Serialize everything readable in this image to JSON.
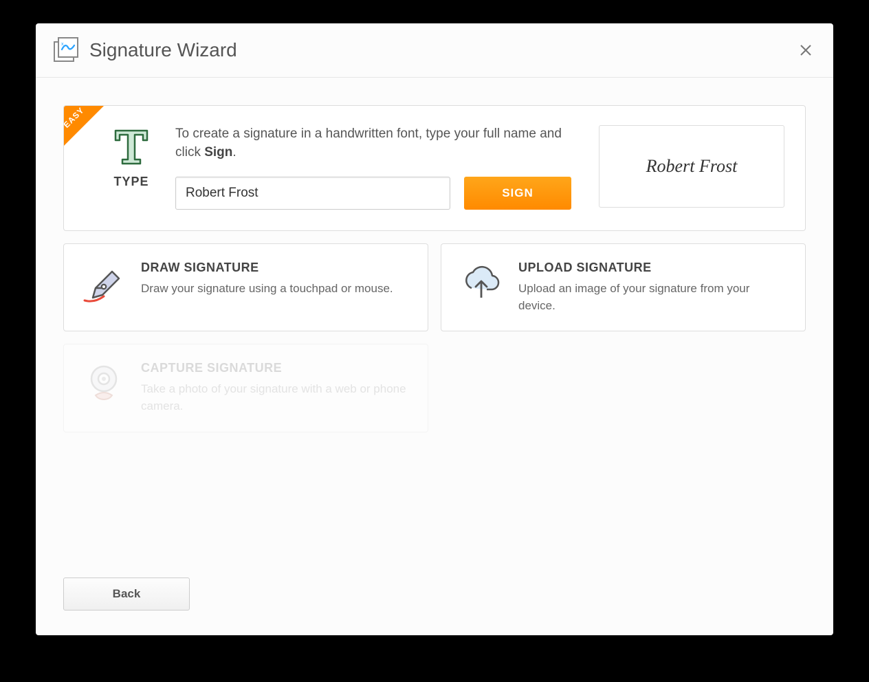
{
  "dialog": {
    "title": "Signature Wizard"
  },
  "type_card": {
    "ribbon": "EASY",
    "icon_label": "TYPE",
    "instruction_pre": "To create a signature in a handwritten font, type your full name and click ",
    "instruction_strong": "Sign",
    "instruction_post": ".",
    "input_value": "Robert Frost",
    "sign_button": "SIGN",
    "preview_text": "Robert Frost"
  },
  "options": {
    "draw": {
      "title": "DRAW SIGNATURE",
      "desc": "Draw your signature using a touchpad or mouse."
    },
    "upload": {
      "title": "UPLOAD SIGNATURE",
      "desc": "Upload an image of your signature from your device."
    },
    "capture": {
      "title": "CAPTURE SIGNATURE",
      "desc": "Take a photo of your signature with a web or phone camera."
    }
  },
  "footer": {
    "back": "Back"
  },
  "colors": {
    "accent": "#ff8a00"
  }
}
